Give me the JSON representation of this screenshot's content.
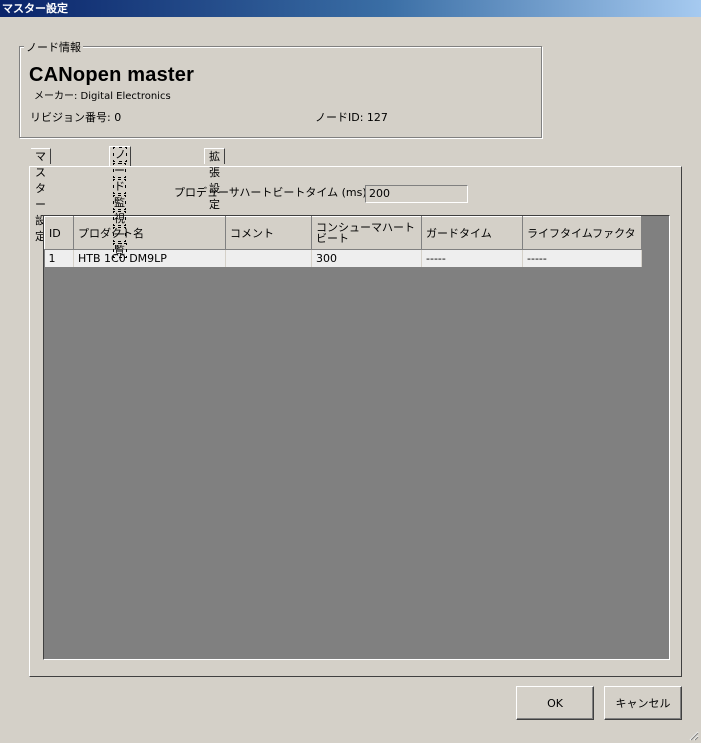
{
  "window": {
    "title": "マスター設定"
  },
  "node_info": {
    "legend": "ノード情報",
    "name": "CANopen master",
    "maker": "メーカー: Digital Electronics",
    "revision": "リビジョン番号: 0",
    "node_id": "ノードID: 127"
  },
  "tabs": [
    {
      "label": "マスター設定",
      "active": false
    },
    {
      "label": "ノード監視一覧",
      "active": true
    },
    {
      "label": "拡張設定",
      "active": false
    }
  ],
  "heartbeat": {
    "label": "プロデューサハートビートタイム (ms)",
    "value": "200"
  },
  "table": {
    "columns": [
      "ID",
      "プロダクト名",
      "コメント",
      "コンシューマハートビート",
      "ガードタイム",
      "ライフタイムファクタ"
    ],
    "rows": [
      [
        "1",
        "HTB 1C0 DM9LP",
        "",
        "300",
        "-----",
        "-----"
      ]
    ]
  },
  "buttons": {
    "ok": "OK",
    "cancel": "キャンセル"
  },
  "colors": {
    "titlebar": "#0a246a",
    "face": "#d4d0c8",
    "grid_bg": "#808080"
  }
}
